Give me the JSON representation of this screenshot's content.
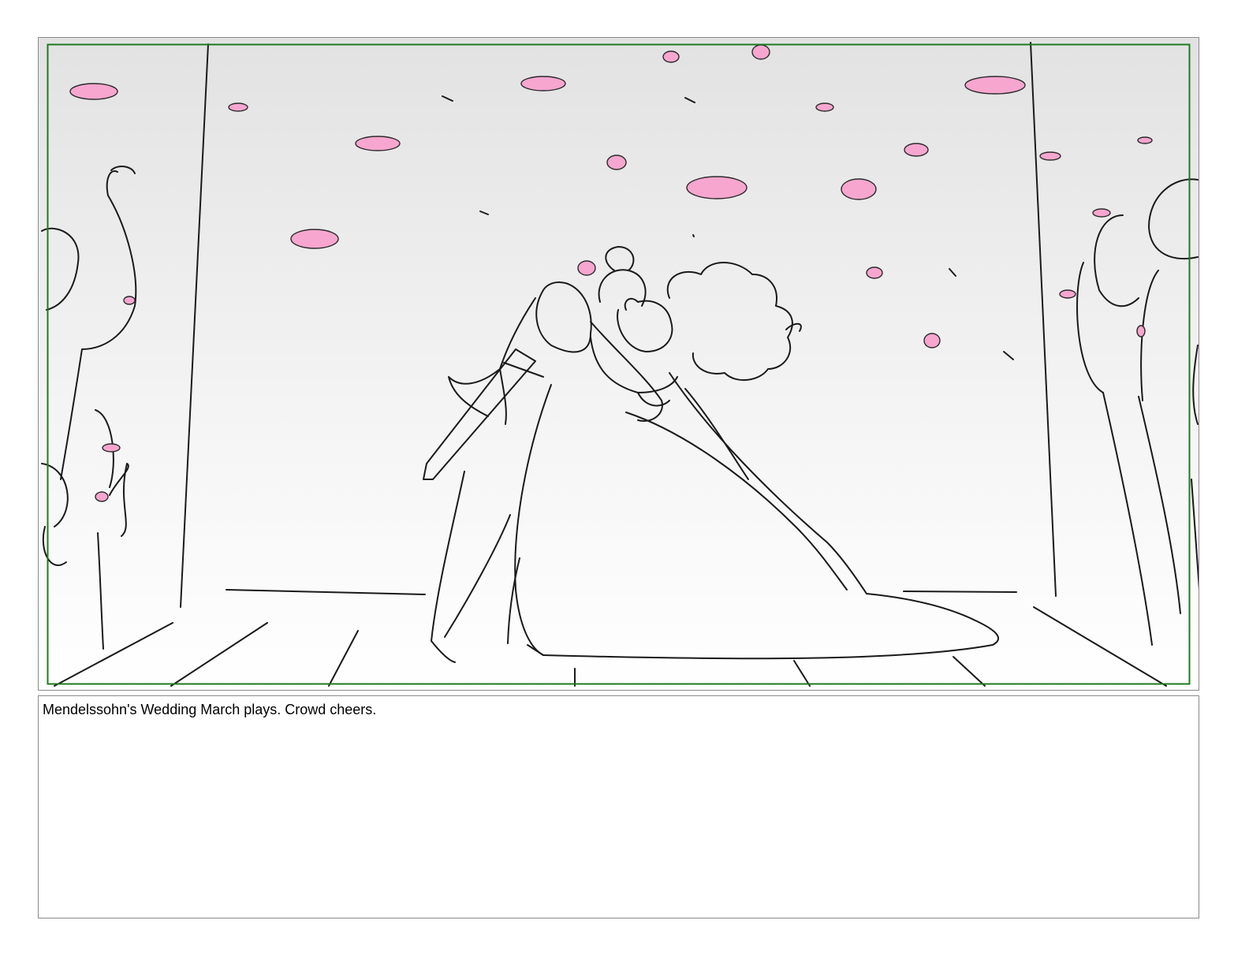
{
  "storyboard": {
    "panel": {
      "image_name": "wedding-kiss-sketch",
      "safe_area_color": "#1f7a1f",
      "petal_color": "#f7a6cf"
    },
    "notes": {
      "text": "Mendelssohn's Wedding March plays. Crowd cheers."
    }
  }
}
